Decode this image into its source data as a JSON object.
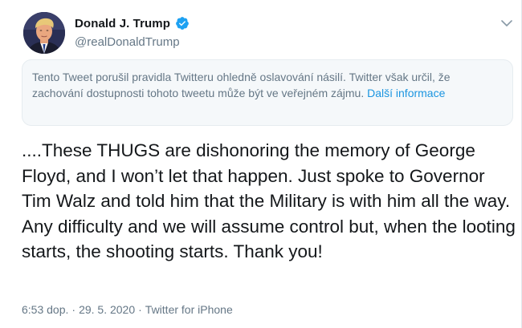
{
  "tweet": {
    "display_name": "Donald J. Trump",
    "handle": "@realDonaldTrump",
    "notice": {
      "text": "Tento Tweet porušil pravidla Twitteru ohledně oslavování násilí. Twitter však určil, že zachování dostupnosti tohoto tweetu může být ve veřejném zájmu.",
      "link": "Další informace"
    },
    "body": "....These THUGS are dishonoring the memory of George Floyd, and I won’t let that happen. Just spoke to Governor Tim Walz and told him that the Military is with him all the way. Any difficulty and we will assume control but, when the looting starts, the shooting starts. Thank you!",
    "time": "6:53 dop.",
    "separator1": "·",
    "date": "29. 5. 2020",
    "separator2": "·",
    "source": "Twitter for iPhone"
  },
  "icons": {
    "verified": "verified-badge-icon",
    "more": "chevron-down-icon",
    "avatar": "profile-photo"
  },
  "colors": {
    "accent": "#1da1f2",
    "link": "#1b95e0",
    "secondary_text": "#657786",
    "primary_text": "#14171a",
    "notice_bg": "#f5f8fa"
  }
}
